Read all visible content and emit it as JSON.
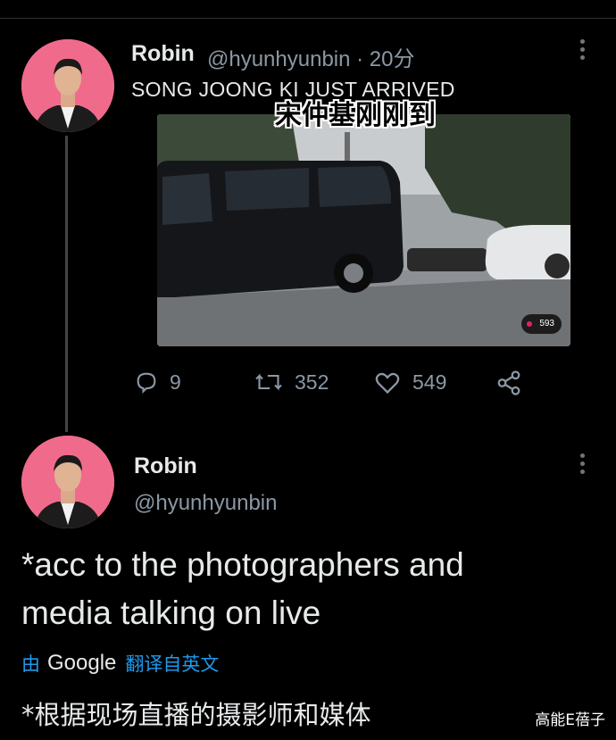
{
  "tweet1": {
    "name": "Robin",
    "handle_time": "@hyunhyunbin · 20分",
    "text": "SONG JOONG KI JUST ARRIVED",
    "caption_cn": "宋仲基刚刚到",
    "media": {
      "views": "593"
    },
    "actions": {
      "replies": "9",
      "retweets": "352",
      "likes": "549"
    }
  },
  "tweet2": {
    "name": "Robin",
    "handle": "@hyunhyunbin",
    "body_line1": "*acc to the photographers and",
    "body_line2": "media talking on live",
    "translate": {
      "by": "由",
      "brand": "Google",
      "action": "翻译自英文"
    },
    "translated": "*根据现场直播的摄影师和媒体"
  },
  "watermark": "高能E蓓子",
  "colors": {
    "background": "#000000",
    "avatar": "#f06b8b",
    "link": "#1d9bf0",
    "muted": "#8b98a5"
  }
}
